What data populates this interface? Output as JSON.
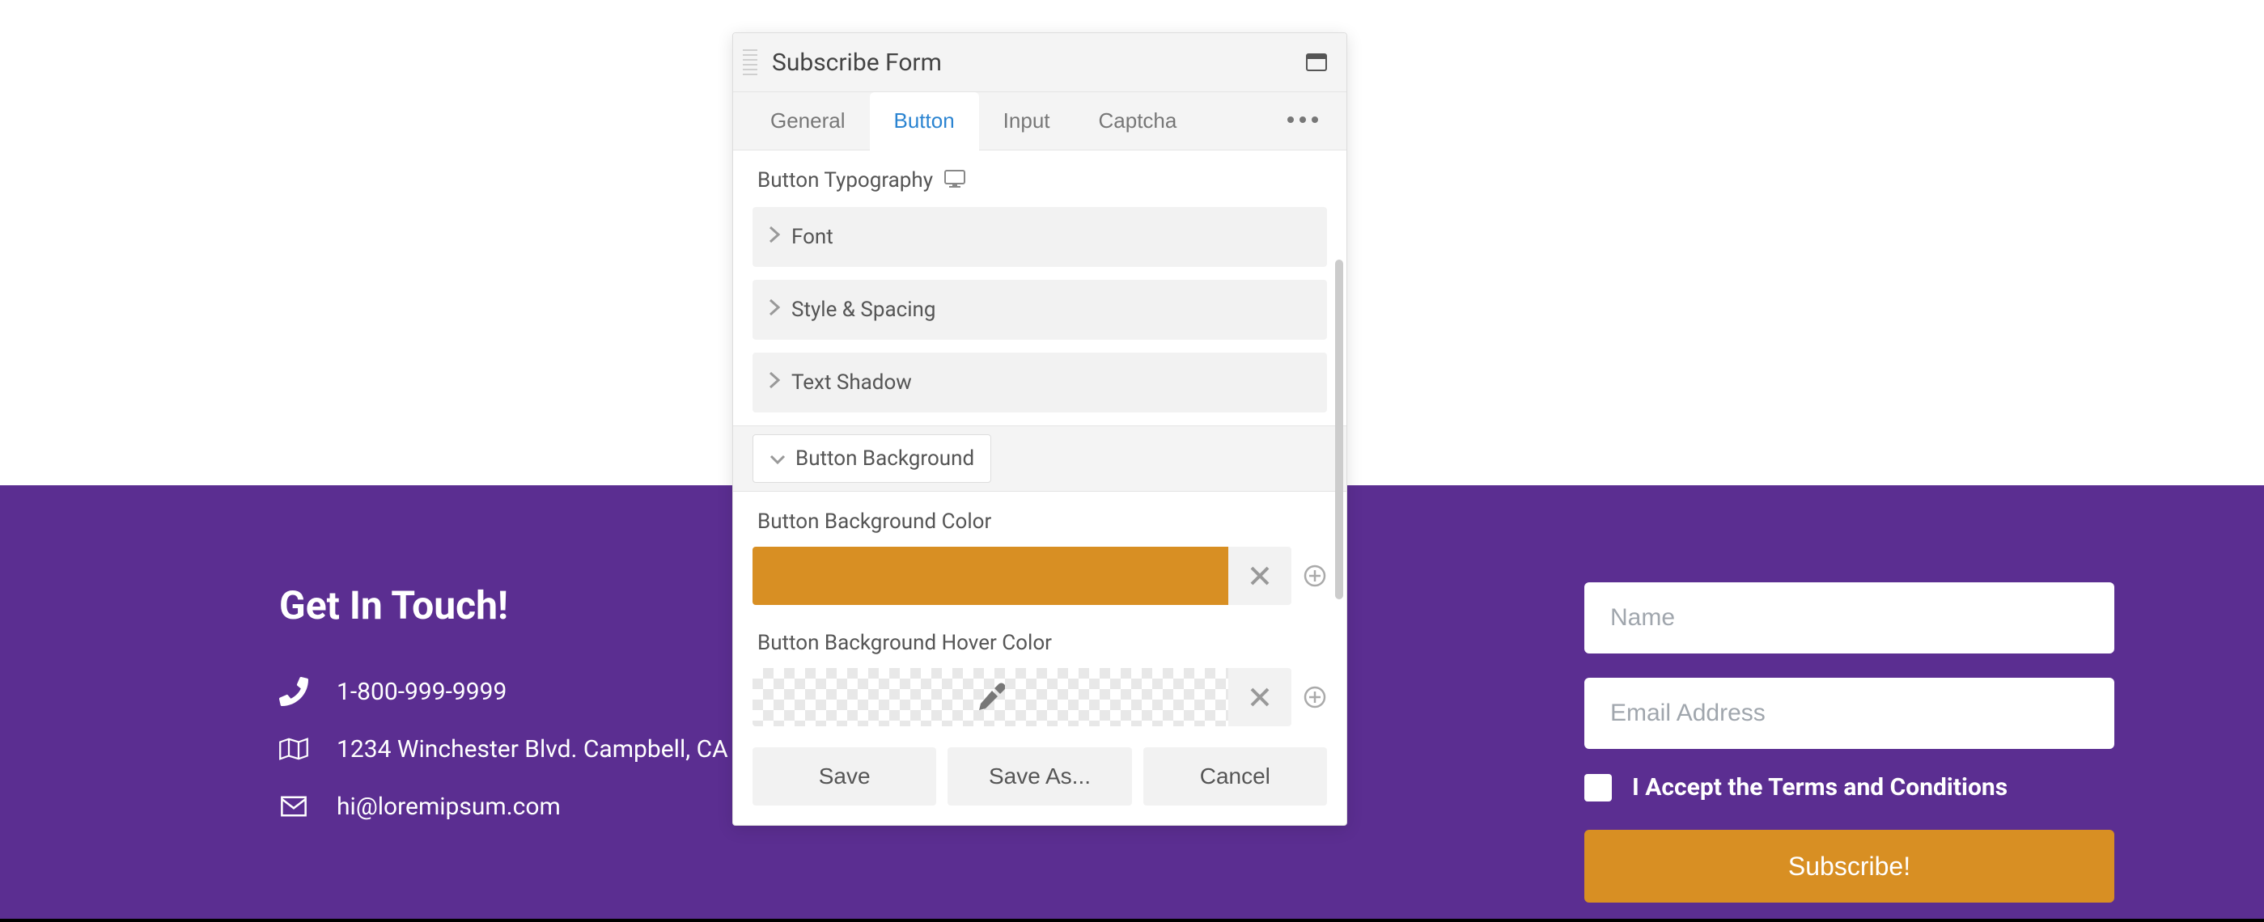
{
  "panel": {
    "title": "Subscribe Form",
    "tabs": {
      "general": "General",
      "button": "Button",
      "input": "Input",
      "captcha": "Captcha"
    },
    "typography": {
      "label": "Button Typography",
      "items": {
        "font": "Font",
        "style_spacing": "Style & Spacing",
        "text_shadow": "Text Shadow"
      }
    },
    "background": {
      "group_label": "Button Background",
      "bg_color": {
        "label": "Button Background Color",
        "value": "#d88f23"
      },
      "hover_color": {
        "label": "Button Background Hover Color",
        "value": "transparent"
      }
    },
    "footer": {
      "save": "Save",
      "save_as": "Save As...",
      "cancel": "Cancel"
    }
  },
  "footer_left": {
    "heading": "Get In Touch!",
    "phone": "1-800-999-9999",
    "address": "1234 Winchester Blvd. Campbell, CA",
    "email": "hi@loremipsum.com"
  },
  "footer_right": {
    "name_placeholder": "Name",
    "email_placeholder": "Email Address",
    "terms_label": "I Accept the Terms and Conditions",
    "submit_label": "Subscribe!"
  }
}
